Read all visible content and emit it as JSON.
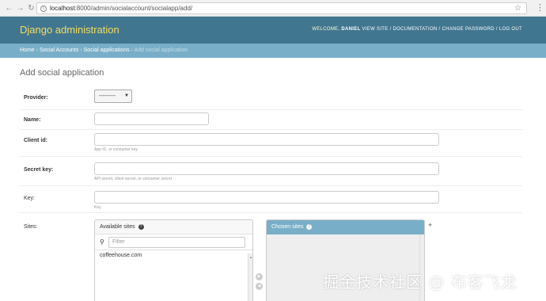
{
  "browser": {
    "url_host": "localhost",
    "url_rest": ":8000/admin/socialaccount/socialapp/add/"
  },
  "header": {
    "brand": "Django administration",
    "welcome": "WELCOME,",
    "user": "DANIEL",
    "links": [
      "VIEW SITE",
      "DOCUMENTATION",
      "CHANGE PASSWORD",
      "LOG OUT"
    ]
  },
  "breadcrumbs": {
    "items": [
      "Home",
      "Social Accounts",
      "Social applications"
    ],
    "separator": "›",
    "current": "Add social application"
  },
  "page": {
    "title": "Add social application"
  },
  "form": {
    "provider": {
      "label": "Provider:",
      "value": "---------"
    },
    "name": {
      "label": "Name:",
      "value": ""
    },
    "client_id": {
      "label": "Client id:",
      "value": "",
      "help": "App ID, or consumer key"
    },
    "secret_key": {
      "label": "Secret key:",
      "value": "",
      "help": "API secret, client secret, or consumer secret"
    },
    "key": {
      "label": "Key:",
      "value": "",
      "help": "Key"
    },
    "sites": {
      "label": "Sites:",
      "available_title": "Available sites",
      "filter_placeholder": "Filter",
      "available_items": [
        "coffeehouse.com"
      ],
      "chosen_title": "Chosen sites"
    }
  },
  "watermark": "掘金技术社区 @ 布客飞龙",
  "colors": {
    "header_bg": "#417690",
    "brand_yellow": "#f5dd5d",
    "breadcrumb_bg": "#79aec8"
  }
}
